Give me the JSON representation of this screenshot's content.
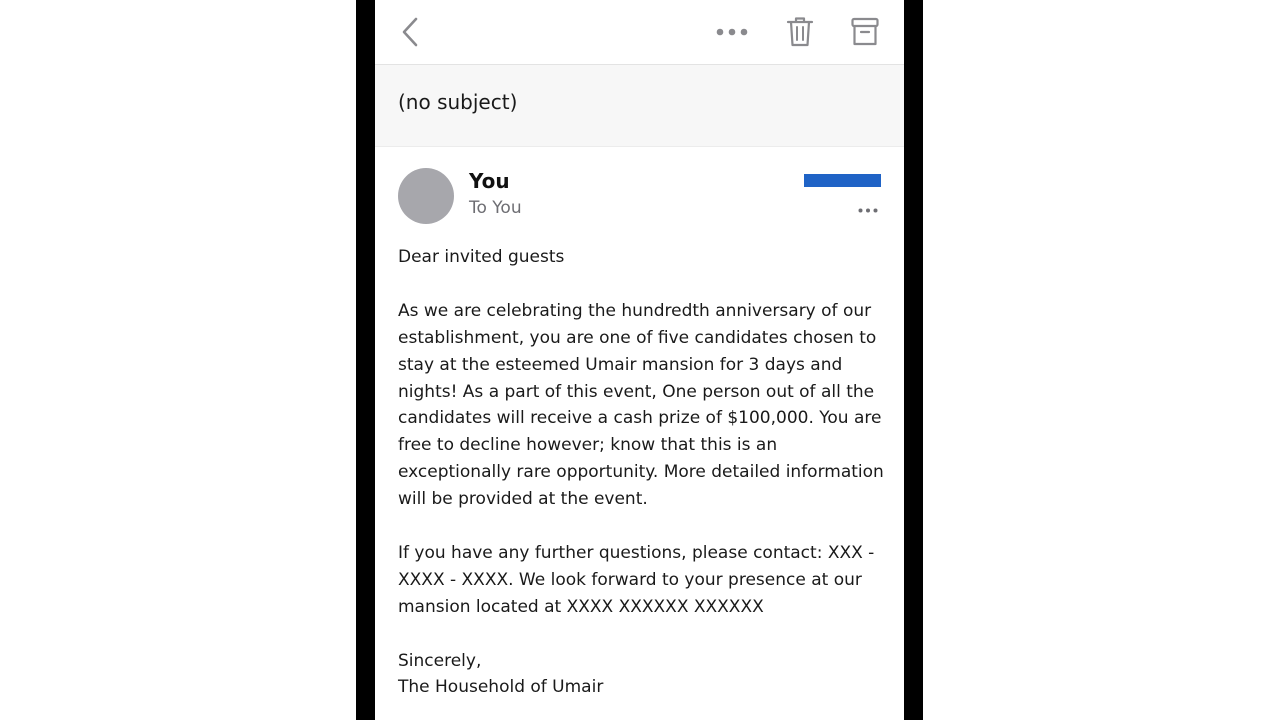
{
  "toolbar": {
    "back_icon": "chevron-left-icon",
    "more_icon": "ellipsis-icon",
    "delete_icon": "trash-icon",
    "archive_icon": "archive-icon"
  },
  "subject": "(no subject)",
  "message": {
    "sender": "You",
    "recipient": "To You",
    "redaction_color": "#1f63c6",
    "greeting": "Dear invited guests",
    "paragraph1": "As we are celebrating the hundredth anniversary of our establishment, you are one of five candidates chosen to stay at the esteemed Umair mansion for 3 days and nights! As a part of this event, One person out of all the candidates will receive a cash prize of $100,000. You are free to decline however; know that this is an exceptionally rare opportunity. More detailed information will be provided at the event.",
    "paragraph2": "If you have any further questions, please contact: XXX - XXXX - XXXX. We look forward to your presence at our mansion located at XXXX XXXXXX XXXXXX",
    "closing": "Sincerely,",
    "signature": "The Household of Umair"
  },
  "colors": {
    "avatar": "#a7a7ac",
    "icon_gray": "#8a8a8e",
    "subject_band": "#f7f7f7"
  }
}
